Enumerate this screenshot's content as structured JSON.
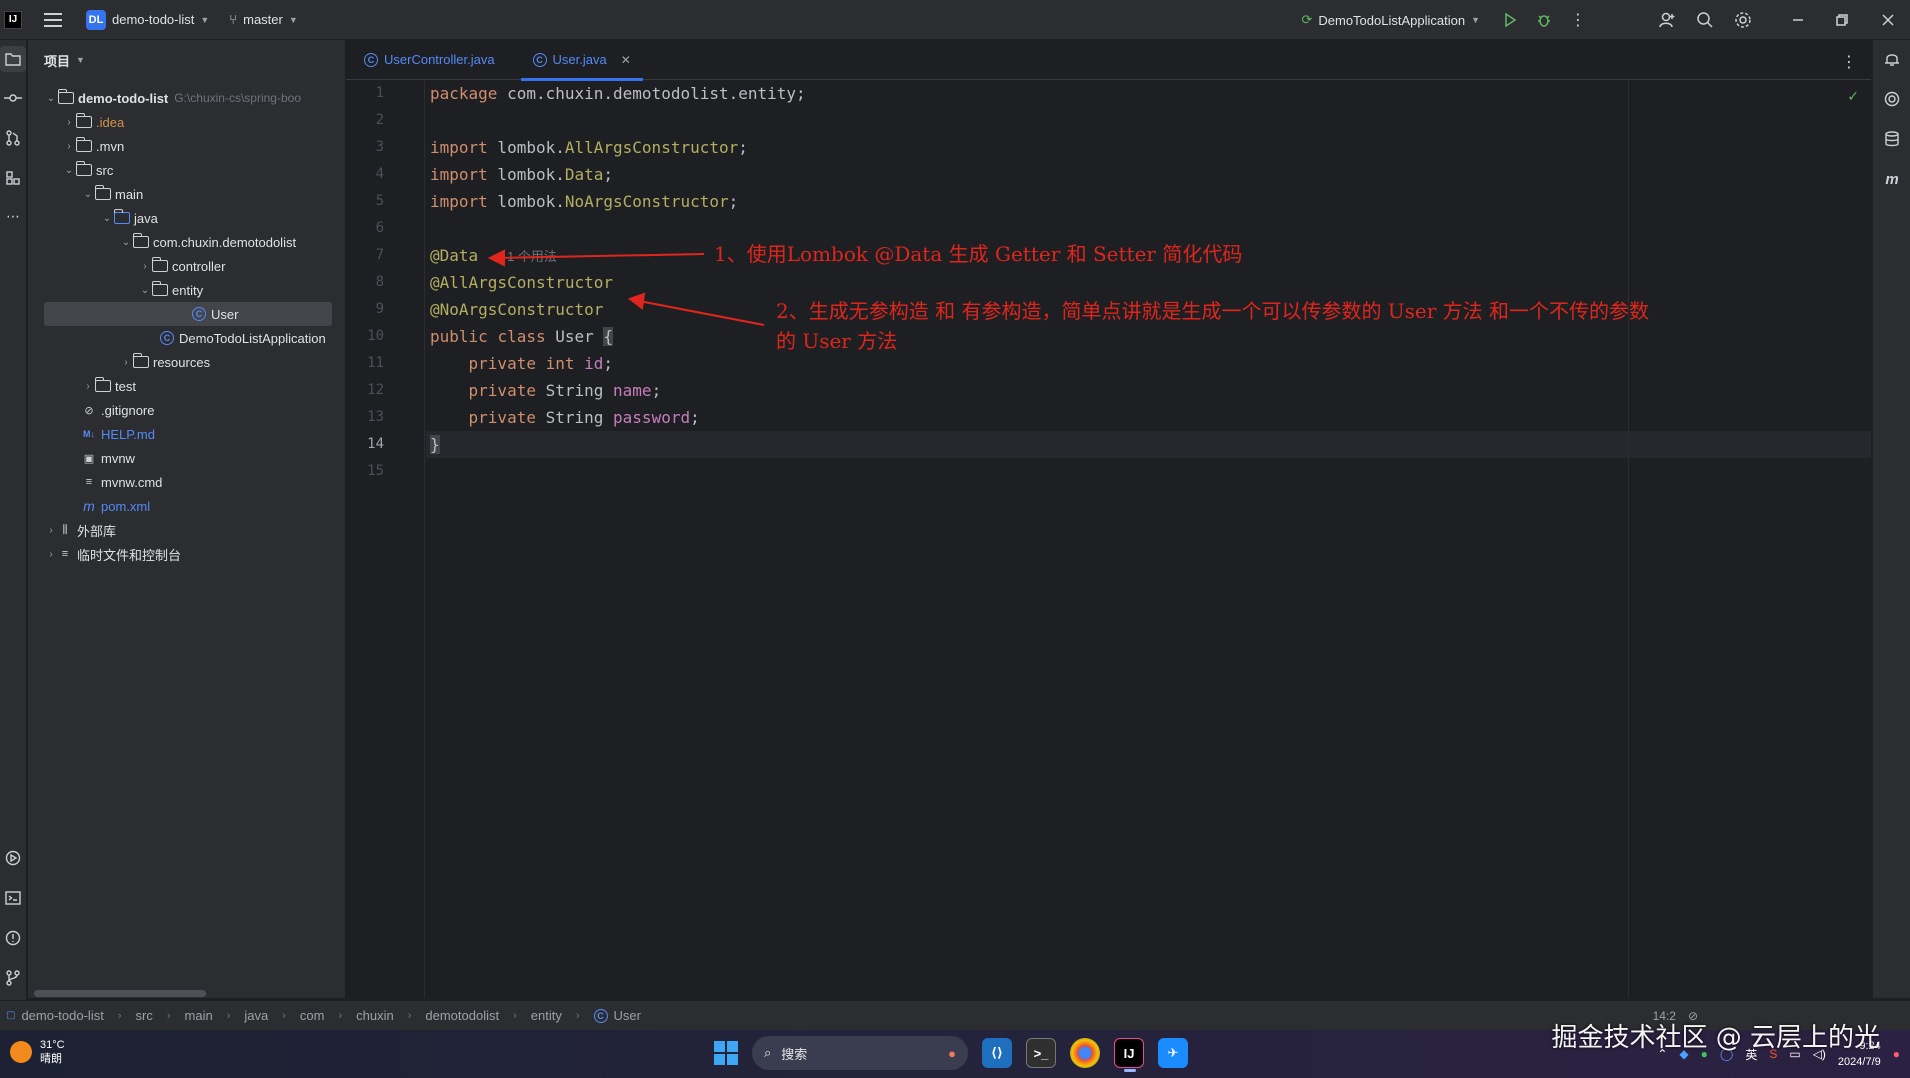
{
  "titlebar": {
    "project_badge": "DL",
    "project_name": "demo-todo-list",
    "branch": "master",
    "run_config": "DemoTodoListApplication"
  },
  "project_panel": {
    "header": "项目",
    "tree": [
      {
        "label": "demo-todo-list",
        "hint": "G:\\chuxin-cs\\spring-boo"
      },
      {
        "label": ".idea"
      },
      {
        "label": ".mvn"
      },
      {
        "label": "src"
      },
      {
        "label": "main"
      },
      {
        "label": "java"
      },
      {
        "label": "com.chuxin.demotodolist"
      },
      {
        "label": "controller"
      },
      {
        "label": "entity"
      },
      {
        "label": "User"
      },
      {
        "label": "DemoTodoListApplication"
      },
      {
        "label": "resources"
      },
      {
        "label": "test"
      },
      {
        "label": ".gitignore"
      },
      {
        "label": "HELP.md"
      },
      {
        "label": "mvnw"
      },
      {
        "label": "mvnw.cmd"
      },
      {
        "label": "pom.xml"
      },
      {
        "label": "外部库"
      },
      {
        "label": "临时文件和控制台"
      }
    ]
  },
  "tabs": [
    {
      "label": "UserController.java"
    },
    {
      "label": "User.java"
    }
  ],
  "editor": {
    "line_numbers": [
      "1",
      "2",
      "3",
      "4",
      "5",
      "6",
      "7",
      "8",
      "9",
      "10",
      "11",
      "12",
      "13",
      "14",
      "15"
    ],
    "code": {
      "l1_kw": "package",
      "l1_rest": " com.chuxin.demotodolist.entity;",
      "l3_kw": "import",
      "l3_pkg": " lombok.",
      "l3_ann": "AllArgsConstructor",
      "l3_end": ";",
      "l4_kw": "import",
      "l4_pkg": " lombok.",
      "l4_ann": "Data",
      "l4_end": ";",
      "l5_kw": "import",
      "l5_pkg": " lombok.",
      "l5_ann": "NoArgsConstructor",
      "l5_end": ";",
      "l7_ann": "@Data",
      "l7_hint": "1 个用法",
      "l8_ann": "@AllArgsConstructor",
      "l9_ann": "@NoArgsConstructor",
      "l10_kw1": "public",
      "l10_kw2": "class",
      "l10_name": " User ",
      "l10_brace": "{",
      "l11_kw1": "private",
      "l11_kw2": "int",
      "l11_fld": "id",
      "l11_end": ";",
      "l12_kw1": "private",
      "l12_type": " String ",
      "l12_fld": "name",
      "l12_end": ";",
      "l13_kw1": "private",
      "l13_type": " String ",
      "l13_fld": "password",
      "l13_end": ";",
      "l14_brace": "}"
    }
  },
  "annotations": {
    "note1": "1、使用Lombok @Data 生成 Getter 和 Setter 简化代码",
    "note2_line1": "2、生成无参构造 和 有参构造，简单点讲就是生成一个可以传参数的 User 方法 和一个不传的参数",
    "note2_line2": "的 User 方法"
  },
  "breadcrumbs": [
    "demo-todo-list",
    "src",
    "main",
    "java",
    "com",
    "chuxin",
    "demotodolist",
    "entity",
    "User"
  ],
  "status": {
    "position": "14:2"
  },
  "taskbar": {
    "temperature": "31°C",
    "weather": "晴朗",
    "search_placeholder": "搜索",
    "ime": "英",
    "time": "9:24",
    "date": "2024/7/9"
  },
  "watermark": "掘金技术社区 @ 云层上的光",
  "colors": {
    "accent": "#3574f0",
    "annotation_red": "#e0261c",
    "keyword": "#cf8e6d",
    "annotation": "#b3ae60",
    "field": "#c77dbb"
  }
}
